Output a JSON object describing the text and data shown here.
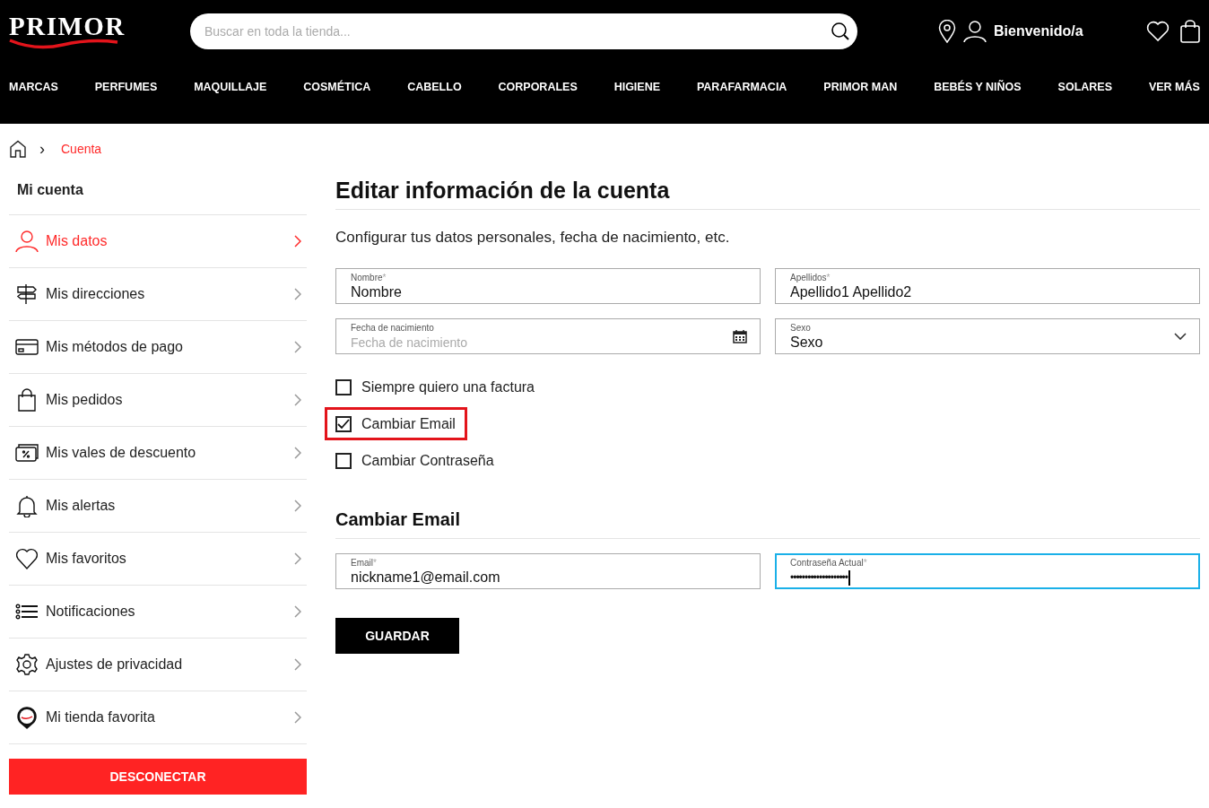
{
  "header": {
    "logo": "PRIMOR",
    "search": {
      "placeholder": "Buscar en toda la tienda..."
    },
    "account_label": "Bienvenido/a"
  },
  "nav": [
    "MARCAS",
    "PERFUMES",
    "MAQUILLAJE",
    "COSMÉTICA",
    "CABELLO",
    "CORPORALES",
    "HIGIENE",
    "PARAFARMACIA",
    "PRIMOR MAN",
    "BEBÉS Y NIÑOS",
    "SOLARES",
    "VER MÁS"
  ],
  "breadcrumb": {
    "separator": "›",
    "current": "Cuenta"
  },
  "sidebar": {
    "title": "Mi cuenta",
    "items": [
      {
        "label": "Mis datos",
        "kind": "user",
        "selected": true
      },
      {
        "label": "Mis direcciones",
        "kind": "signpost",
        "selected": false
      },
      {
        "label": "Mis métodos de pago",
        "kind": "card",
        "selected": false
      },
      {
        "label": "Mis pedidos",
        "kind": "bag",
        "selected": false
      },
      {
        "label": "Mis vales de descuento",
        "kind": "voucher",
        "selected": false
      },
      {
        "label": "Mis alertas",
        "kind": "bell",
        "selected": false
      },
      {
        "label": "Mis favoritos",
        "kind": "heart",
        "selected": false
      },
      {
        "label": "Notificaciones",
        "kind": "list",
        "selected": false
      },
      {
        "label": "Ajustes de privacidad",
        "kind": "gear",
        "selected": false
      },
      {
        "label": "Mi tienda favorita",
        "kind": "pin",
        "selected": false
      }
    ],
    "logout": "DESCONECTAR"
  },
  "main": {
    "title": "Editar información de la cuenta",
    "subtitle": "Configurar tus datos personales, fecha de nacimiento, etc.",
    "fields": [
      {
        "label": "Nombre",
        "required_mark": "*",
        "kind": "text",
        "value": "Nombre",
        "focused": false
      },
      {
        "label": "Apellidos",
        "required_mark": "*",
        "kind": "text",
        "value": "Apellido1 Apellido2",
        "focused": false
      },
      {
        "label": "Fecha de nacimiento",
        "kind": "date",
        "placeholder": "Fecha de nacimiento",
        "focused": false
      },
      {
        "label": "Sexo",
        "kind": "select",
        "value": "Sexo",
        "focused": false
      }
    ],
    "checkboxes": [
      {
        "label": "Siempre quiero una factura",
        "checked": false,
        "highlighted": false
      },
      {
        "label": "Cambiar Email",
        "checked": true,
        "highlighted": true
      },
      {
        "label": "Cambiar Contraseña",
        "checked": false,
        "highlighted": false
      }
    ],
    "section": {
      "title": "Cambiar Email",
      "fields": [
        {
          "label": "Email",
          "required_mark": "*",
          "kind": "text",
          "value": "nickname1@email.com",
          "focused": false
        },
        {
          "label": "Contraseña Actual",
          "required_mark": "*",
          "kind": "password",
          "value": "••••••••••••••••••••",
          "focused": true
        }
      ]
    },
    "save": "GUARDAR"
  }
}
